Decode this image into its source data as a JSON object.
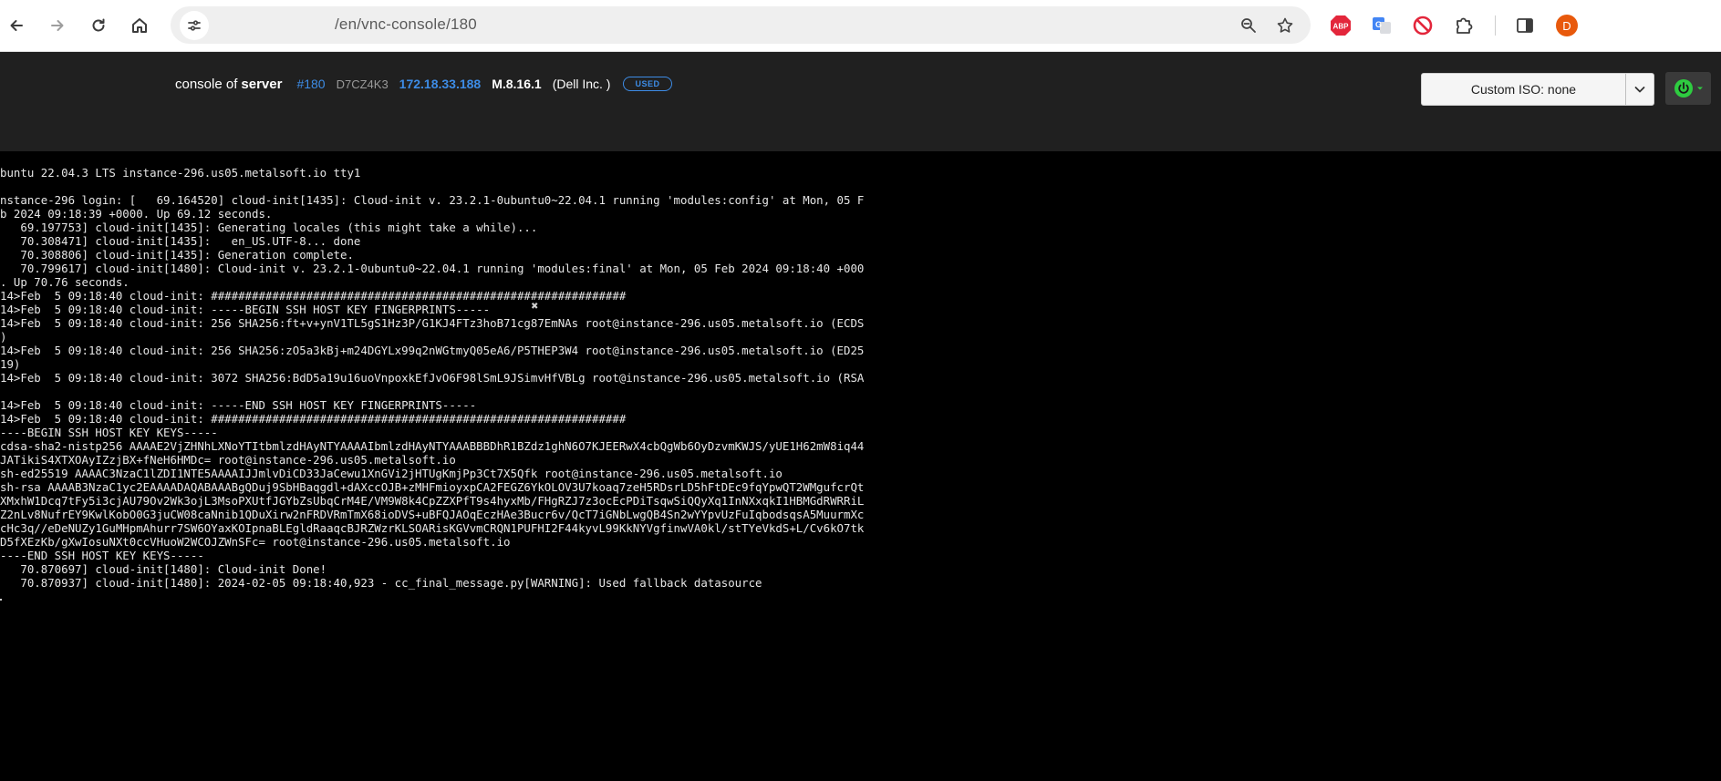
{
  "browser": {
    "url": "/en/vnc-console/180",
    "icons": {
      "back": "arrow-left-icon",
      "forward": "arrow-right-icon",
      "reload": "reload-icon",
      "home": "home-icon",
      "site_info": "tune-icon",
      "zoom": "zoom-icon",
      "bookmark": "star-icon",
      "adblock": "abp-icon",
      "translate": "translate-icon",
      "blocker": "block-icon",
      "extensions": "puzzle-icon",
      "side_panel": "side-panel-icon"
    },
    "adblock_label": "ABP",
    "profile_initial": "D",
    "colors": {
      "profile": "#e8590c",
      "adblock": "#e3263b",
      "translate": "#4285f4",
      "blocker": "#e3263b"
    }
  },
  "header": {
    "prefix": "console of",
    "entity": "server",
    "server_id": "#180",
    "serial": "D7CZ4K3",
    "ip": "172.18.33.188",
    "firmware": "M.8.16.1",
    "vendor": "(Dell Inc.  )",
    "status_badge": "USED",
    "custom_iso": "Custom ISO: none",
    "colors": {
      "accent": "#3d8ce6",
      "power": "#2ecc40",
      "header_bg": "#202020"
    }
  },
  "terminal": {
    "lines": [
      "buntu 22.04.3 LTS instance-296.us05.metalsoft.io tty1",
      "",
      "nstance-296 login: [   69.164520] cloud-init[1435]: Cloud-init v. 23.2.1-0ubuntu0~22.04.1 running 'modules:config' at Mon, 05 F",
      "b 2024 09:18:39 +0000. Up 69.12 seconds.",
      "   69.197753] cloud-init[1435]: Generating locales (this might take a while)...",
      "   70.308471] cloud-init[1435]:   en_US.UTF-8... done",
      "   70.308806] cloud-init[1435]: Generation complete.",
      "   70.799617] cloud-init[1480]: Cloud-init v. 23.2.1-0ubuntu0~22.04.1 running 'modules:final' at Mon, 05 Feb 2024 09:18:40 +000",
      ". Up 70.76 seconds.",
      "14>Feb  5 09:18:40 cloud-init: #############################################################",
      "14>Feb  5 09:18:40 cloud-init: -----BEGIN SSH HOST KEY FINGERPRINTS-----",
      "14>Feb  5 09:18:40 cloud-init: 256 SHA256:ft+v+ynV1TL5gS1Hz3P/G1KJ4FTz3hoB71cg87EmNAs root@instance-296.us05.metalsoft.io (ECDS",
      ")",
      "14>Feb  5 09:18:40 cloud-init: 256 SHA256:zO5a3kBj+m24DGYLx99q2nWGtmyQ05eA6/P5THEP3W4 root@instance-296.us05.metalsoft.io (ED25",
      "19)",
      "14>Feb  5 09:18:40 cloud-init: 3072 SHA256:BdD5a19u16uoVnpoxkEfJvO6F98lSmL9JSimvHfVBLg root@instance-296.us05.metalsoft.io (RSA",
      "",
      "14>Feb  5 09:18:40 cloud-init: -----END SSH HOST KEY FINGERPRINTS-----",
      "14>Feb  5 09:18:40 cloud-init: #############################################################",
      "----BEGIN SSH HOST KEY KEYS-----",
      "cdsa-sha2-nistp256 AAAAE2VjZHNhLXNoYTItbmlzdHAyNTYAAAAIbmlzdHAyNTYAAABBBDhR1BZdz1ghN6O7KJEERwX4cbQgWb6OyDzvmKWJS/yUE1H62mW8iq44",
      "JATikiS4XTXOAyIZzjBX+fNeH6HMDc= root@instance-296.us05.metalsoft.io",
      "sh-ed25519 AAAAC3NzaC1lZDI1NTE5AAAAIJJmlvDiCD33JaCewu1XnGVi2jHTUgKmjPp3Ct7X5Qfk root@instance-296.us05.metalsoft.io",
      "sh-rsa AAAAB3NzaC1yc2EAAAADAQABAAABgQDuj9SbHBaqgdl+dAXccOJB+zMHFmioyxpCA2FEGZ6YkOLOV3U7koaq7zeH5RDsrLD5hFtDEc9fqYpwQT2WMgufcrQt",
      "XMxhW1Dcq7tFy5i3cjAU79Ov2Wk3ojL3MsoPXUtfJGYbZsUbqCrM4E/VM9W8k4CpZZXPfT9s4hyxMb/FHgRZJ7z3ocEcPDiTsqwSiQQyXq1InNXxqkI1HBMGdRWRRiL",
      "Z2nLv8NufrEY9KwlKobO0G3juCW08caNnib1QDuXirw2nFRDVRmTmX68ioDVS+uBFQJAOqEczHAe3Bucr6v/QcT7iGNbLwgQB4Sn2wYYpvUzFuIqbodsqsA5MuurmXc",
      "cHc3q//eDeNUZy1GuMHpmAhurr7SW6OYaxKOIpnaBLEgldRaaqcBJRZWzrKLSOARisKGVvmCRQN1PUFHI2F44kyvL99KkNYVgfinwVA0kl/stTYeVkdS+L/Cv6kO7tk",
      "D5fXEzKb/gXwIosuNXt0ccVHuoW2WCOJZWnSFc= root@instance-296.us05.metalsoft.io",
      "----END SSH HOST KEY KEYS-----",
      "   70.870697] cloud-init[1480]: Cloud-init Done!",
      "   70.870937] cloud-init[1480]: 2024-02-05 09:18:40,923 - cc_final_message.py[WARNING]: Used fallback datasource"
    ]
  }
}
